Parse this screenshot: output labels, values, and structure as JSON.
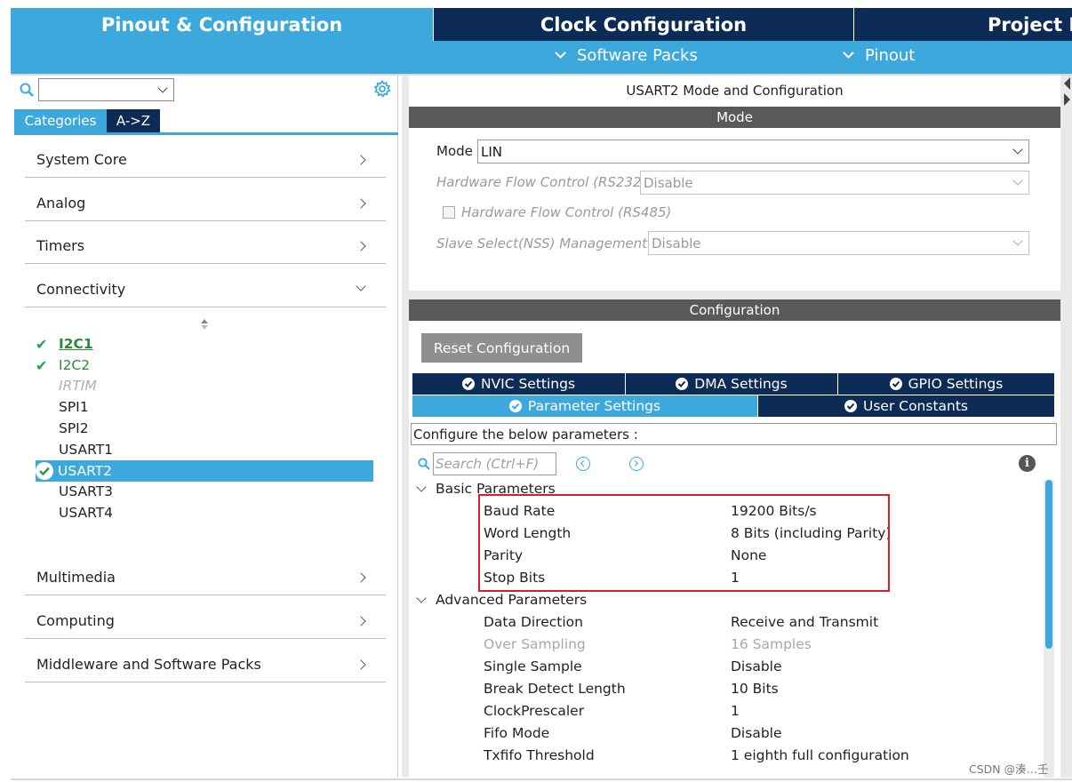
{
  "top_tabs": {
    "pinout": "Pinout & Configuration",
    "clock": "Clock Configuration",
    "project": "Project M"
  },
  "sub_toolbar": {
    "software_packs": "Software Packs",
    "pinout": "Pinout"
  },
  "left": {
    "search_value": "",
    "tabs": {
      "categories": "Categories",
      "az": "A->Z"
    },
    "categories": [
      {
        "label": "System Core"
      },
      {
        "label": "Analog"
      },
      {
        "label": "Timers"
      },
      {
        "label": "Connectivity"
      },
      {
        "label": "Multimedia"
      },
      {
        "label": "Computing"
      },
      {
        "label": "Middleware and Software Packs"
      }
    ],
    "peripherals": [
      {
        "label": "I2C1",
        "state": "configured"
      },
      {
        "label": "I2C2",
        "state": "configured"
      },
      {
        "label": "IRTIM",
        "state": "disabled"
      },
      {
        "label": "SPI1",
        "state": "normal"
      },
      {
        "label": "SPI2",
        "state": "normal"
      },
      {
        "label": "USART1",
        "state": "normal"
      },
      {
        "label": "USART2",
        "state": "selected"
      },
      {
        "label": "USART3",
        "state": "normal"
      },
      {
        "label": "USART4",
        "state": "normal"
      }
    ]
  },
  "right": {
    "title": "USART2 Mode and Configuration",
    "mode_header": "Mode",
    "mode": {
      "mode_label": "Mode",
      "mode_value": "LIN",
      "hw_flow_232_label": "Hardware Flow Control (RS232)",
      "hw_flow_232_value": "Disable",
      "hw_flow_485_label": "Hardware Flow Control (RS485)",
      "nss_label": "Slave Select(NSS) Management",
      "nss_value": "Disable"
    },
    "config_header": "Configuration",
    "reset_button": "Reset Configuration",
    "tabs": {
      "nvic": "NVIC Settings",
      "dma": "DMA Settings",
      "gpio": "GPIO Settings",
      "parameter": "Parameter Settings",
      "user_constants": "User Constants"
    },
    "hint": "Configure the below parameters :",
    "search_placeholder": "Search (Ctrl+F)",
    "basic_group": "Basic Parameters",
    "basic_params": [
      {
        "name": "Baud Rate",
        "value": "19200 Bits/s"
      },
      {
        "name": "Word Length",
        "value": "8 Bits (including Parity)"
      },
      {
        "name": "Parity",
        "value": "None"
      },
      {
        "name": "Stop Bits",
        "value": "1"
      }
    ],
    "advanced_group": "Advanced Parameters",
    "advanced_params": [
      {
        "name": "Data Direction",
        "value": "Receive and Transmit"
      },
      {
        "name": "Over Sampling",
        "value": "16 Samples",
        "disabled": true
      },
      {
        "name": "Single Sample",
        "value": "Disable"
      },
      {
        "name": "Break Detect Length",
        "value": "10 Bits"
      },
      {
        "name": "ClockPrescaler",
        "value": "1"
      },
      {
        "name": "Fifo Mode",
        "value": "Disable"
      },
      {
        "name": "Txfifo Threshold",
        "value": "1 eighth full configuration"
      }
    ]
  },
  "watermark": "CSDN @湊…壬",
  "colors": {
    "accent_blue": "#3ca8dc",
    "dark_navy": "#0c2b56",
    "header_gray": "#595959",
    "highlight_red": "#d0212a",
    "check_green": "#2aa24a"
  }
}
